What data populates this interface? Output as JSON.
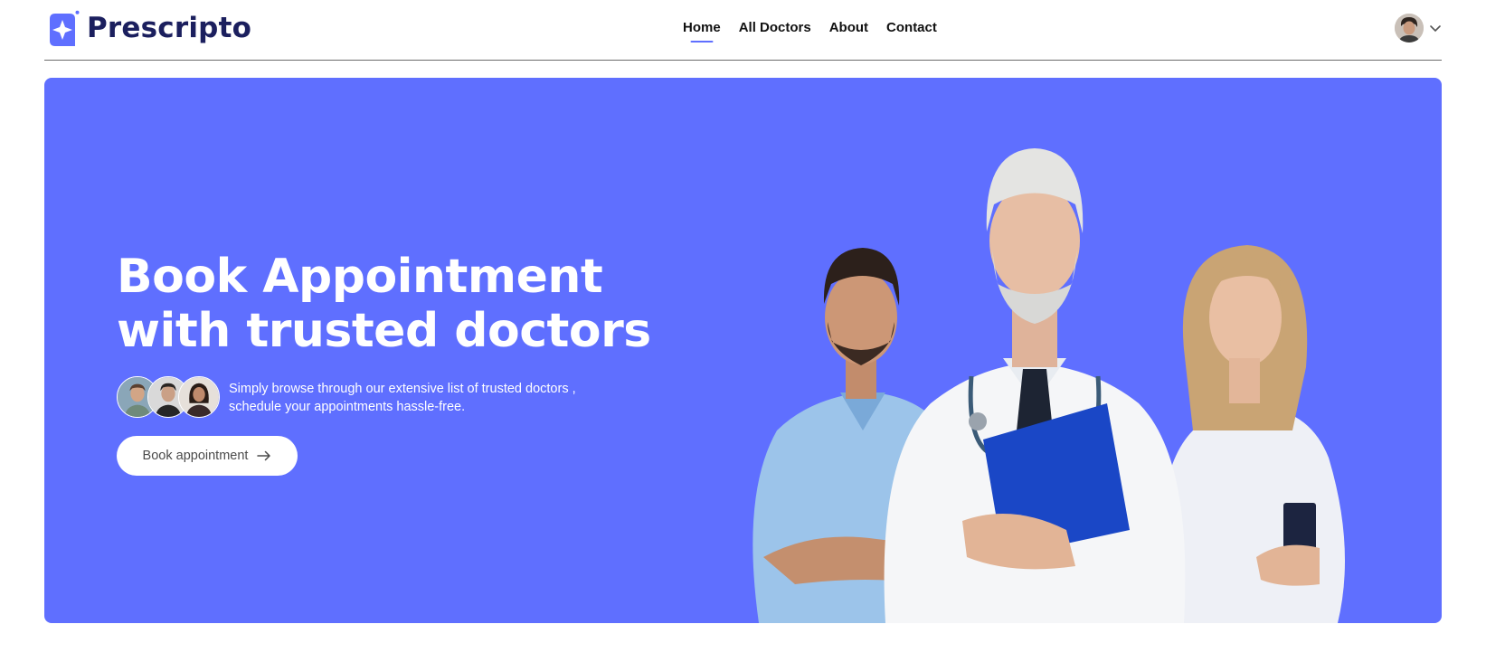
{
  "brand": {
    "name": "Prescripto",
    "accent": "#5f6fff",
    "logo_icon": "star-badge-icon"
  },
  "nav": {
    "items": [
      {
        "label": "Home",
        "active": true
      },
      {
        "label": "All Doctors",
        "active": false
      },
      {
        "label": "About",
        "active": false
      },
      {
        "label": "Contact",
        "active": false
      }
    ],
    "profile_menu_icon": "chevron-down-icon"
  },
  "hero": {
    "background": "#5f6fff",
    "headline_line1": "Book Appointment",
    "headline_line2": "with trusted doctors",
    "subtitle_line1": "Simply browse through our extensive list of trusted doctors ,",
    "subtitle_line2": "schedule your appointments hassle-free.",
    "cta_label": "Book appointment",
    "cta_icon": "arrow-right-icon"
  }
}
